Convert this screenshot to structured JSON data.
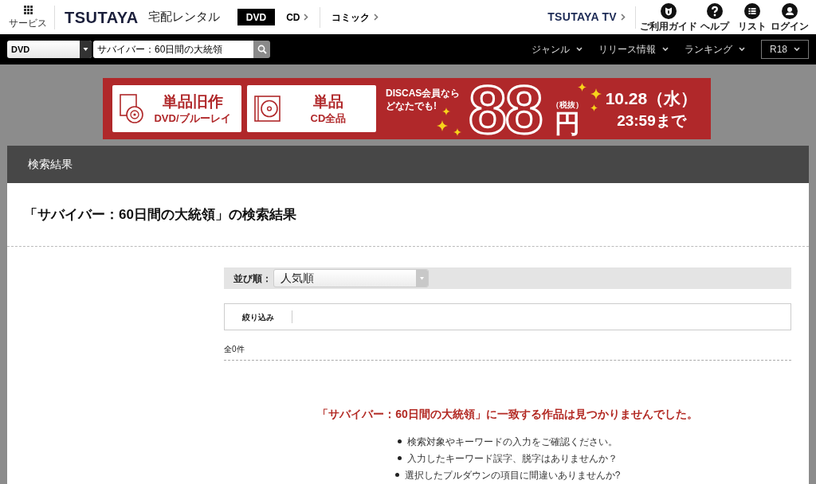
{
  "header": {
    "services": {
      "label": "サービス"
    },
    "logo": {
      "brand": "TSUTAYA",
      "service": "宅配レンタル"
    },
    "tabs": [
      {
        "label": "DVD",
        "selected": true
      },
      {
        "label": "CD",
        "selected": false
      },
      {
        "label": "コミック",
        "selected": false
      }
    ],
    "tv_link": {
      "label": "TSUTAYA TV"
    },
    "user_menu": [
      {
        "kind": "guide",
        "label": "ご利用ガイド"
      },
      {
        "kind": "help",
        "label": "ヘルプ"
      },
      {
        "kind": "list",
        "label": "リスト"
      },
      {
        "kind": "login",
        "label": "ログイン"
      }
    ]
  },
  "search_bar": {
    "category": "DVD",
    "query": "サバイバー：60日間の大統領",
    "menus": [
      {
        "label": "ジャンル"
      },
      {
        "label": "リリース情報"
      },
      {
        "label": "ランキング"
      }
    ],
    "rating_filter": "R18"
  },
  "banner": {
    "offers": [
      {
        "kind": "dvd",
        "title": "単品旧作",
        "subtitle": "DVD/ブルーレイ"
      },
      {
        "kind": "cd",
        "title": "単品",
        "subtitle": "CD全品"
      }
    ],
    "eligibility": [
      "DISCAS会員なら",
      "どなたでも!"
    ],
    "price": "88",
    "tax_note": "（税抜）",
    "currency": "円",
    "deadline_date": "10.28（水）",
    "deadline_time": "23:59まで"
  },
  "results": {
    "section_title": "検索結果",
    "heading": "「サバイバー：60日間の大統領」の検索結果",
    "sort": {
      "label": "並び順：",
      "value": "人気順"
    },
    "filter": {
      "label": "絞り込み"
    },
    "count": "全0件",
    "message": "「サバイバー：60日間の大統領」に一致する作品は見つかりませんでした。",
    "tips": [
      "検索対象やキーワードの入力をご確認ください。",
      "入力したキーワード誤字、脱字はありませんか？",
      "選択したプルダウンの項目に間違いありませんか?"
    ]
  }
}
